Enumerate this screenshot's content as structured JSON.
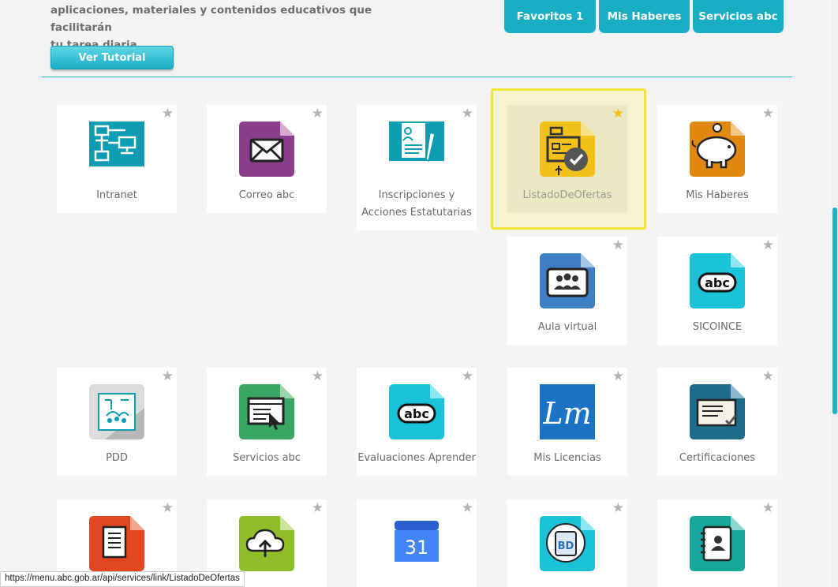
{
  "header": {
    "intro_line1": "aplicaciones, materiales y contenidos educativos que facilitarán",
    "intro_line2": "tu tarea diaria.",
    "tutorial_label": "Ver Tutorial",
    "tabs": [
      {
        "label": "Favoritos 1"
      },
      {
        "label": "Mis Haberes"
      },
      {
        "label": "Servicios abc"
      }
    ]
  },
  "colors": {
    "accent": "#18aec4",
    "highlight_border": "#f1e33a",
    "favorite_star": "#f2c21b",
    "inactive_star": "#b3b3b3"
  },
  "apps": [
    {
      "label": "Intranet",
      "icon": "network-icon",
      "favorite": false
    },
    {
      "label": "Correo abc",
      "icon": "mail-icon",
      "favorite": false
    },
    {
      "label": "Inscripciones y Acciones Estatutarias",
      "icon": "form-icon",
      "favorite": false
    },
    {
      "label": "ListadoDeOfertas",
      "icon": "id-card-check-icon",
      "favorite": true
    },
    {
      "label": "Mis Haberes",
      "icon": "piggy-bank-icon",
      "favorite": false
    },
    {
      "label": "Aula virtual",
      "icon": "classroom-icon",
      "favorite": false
    },
    {
      "label": "SICOINCE",
      "icon": "abc-logo-icon",
      "favorite": false
    },
    {
      "label": "PDD",
      "icon": "school-building-icon",
      "favorite": false
    },
    {
      "label": "Servicios abc",
      "icon": "browser-cursor-icon",
      "favorite": false
    },
    {
      "label": "Evaluaciones Aprender",
      "icon": "abc-logo-icon",
      "favorite": false
    },
    {
      "label": "Mis Licencias",
      "icon": "lm-logo-icon",
      "favorite": false
    },
    {
      "label": "Certificaciones",
      "icon": "certificate-icon",
      "favorite": false
    },
    {
      "label": "",
      "icon": "documents-icon",
      "favorite": false
    },
    {
      "label": "",
      "icon": "cloud-upload-icon",
      "favorite": false
    },
    {
      "label": "",
      "icon": "calendar-icon",
      "favorite": false
    },
    {
      "label": "",
      "icon": "digital-bd-icon",
      "favorite": false
    },
    {
      "label": "",
      "icon": "contact-book-icon",
      "favorite": false
    }
  ],
  "calendar_day": "31",
  "status_url": "https://menu.abc.gob.ar/api/services/link/ListadoDeOfertas"
}
